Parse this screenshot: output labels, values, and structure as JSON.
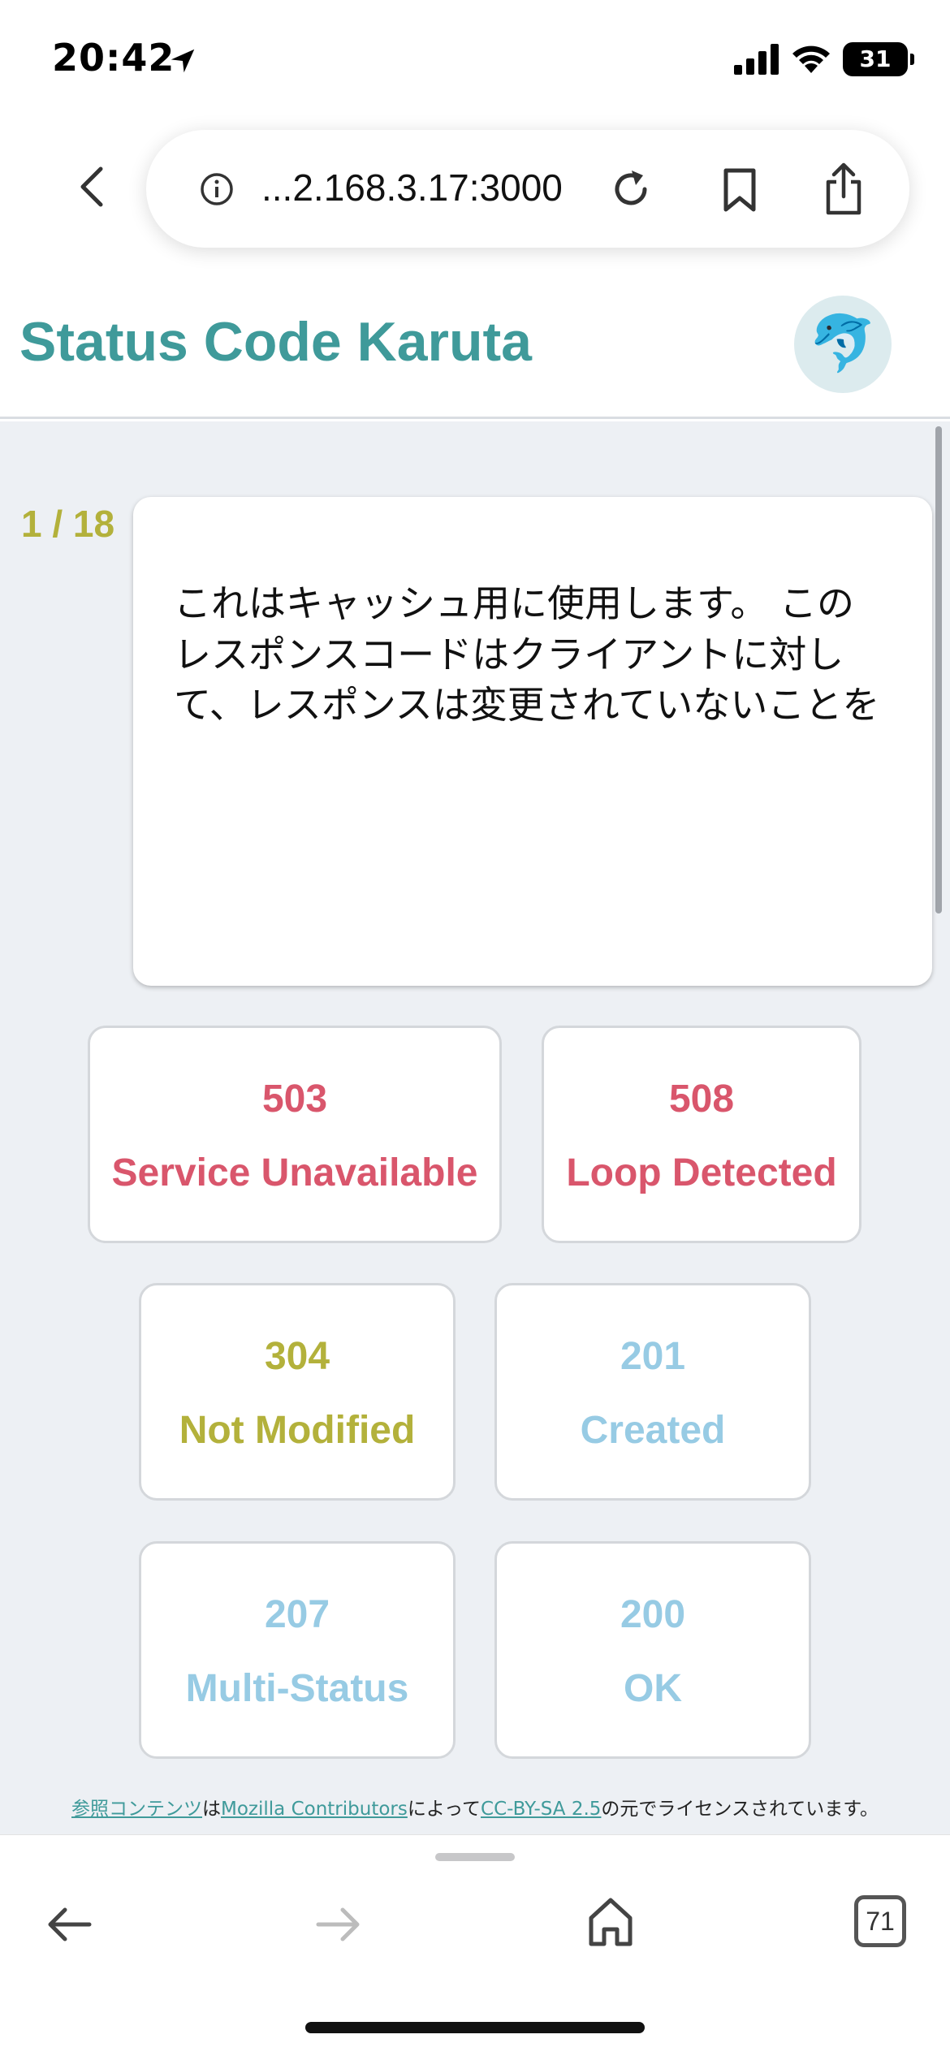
{
  "status_bar": {
    "time": "20:42",
    "battery": "31",
    "icons": [
      "location-arrow-icon",
      "cellular-signal-icon",
      "wifi-icon",
      "battery-icon"
    ]
  },
  "browser": {
    "url": "...2.168.3.17:3000",
    "icons": [
      "chevron-left-icon",
      "info-icon",
      "reload-icon",
      "bookmark-icon",
      "share-icon"
    ]
  },
  "app": {
    "title": "Status Code Karuta",
    "avatar_emoji": "🐬"
  },
  "quiz": {
    "counter": "1 / 18",
    "description": "これはキャッシュ用に使用します。 このレスポンスコードはクライアントに対して、レスポンスは変更されていないことを"
  },
  "options": [
    {
      "code": "503",
      "name": "Service Unavailable",
      "color": "#d9566c"
    },
    {
      "code": "508",
      "name": "Loop Detected",
      "color": "#d9566c"
    },
    {
      "code": "304",
      "name": "Not Modified",
      "color": "#b3b13b"
    },
    {
      "code": "201",
      "name": "Created",
      "color": "#97cbe4"
    },
    {
      "code": "207",
      "name": "Multi-Status",
      "color": "#97cbe4"
    },
    {
      "code": "200",
      "name": "OK",
      "color": "#97cbe4"
    }
  ],
  "attribution": {
    "link1": "参照コンテンツ",
    "text1": "は",
    "link2": "Mozilla Contributors",
    "text2": "によって",
    "link3": "CC-BY-SA 2.5",
    "text3": "の元でライセンスされています。"
  },
  "toolbar": {
    "tabs_count": "71",
    "icons": [
      "arrow-left-icon",
      "arrow-right-icon",
      "home-icon",
      "tabs-icon"
    ]
  },
  "colors": {
    "accent": "#3f9a9a",
    "counter": "#b3b13b",
    "background": "#edf0f4"
  }
}
